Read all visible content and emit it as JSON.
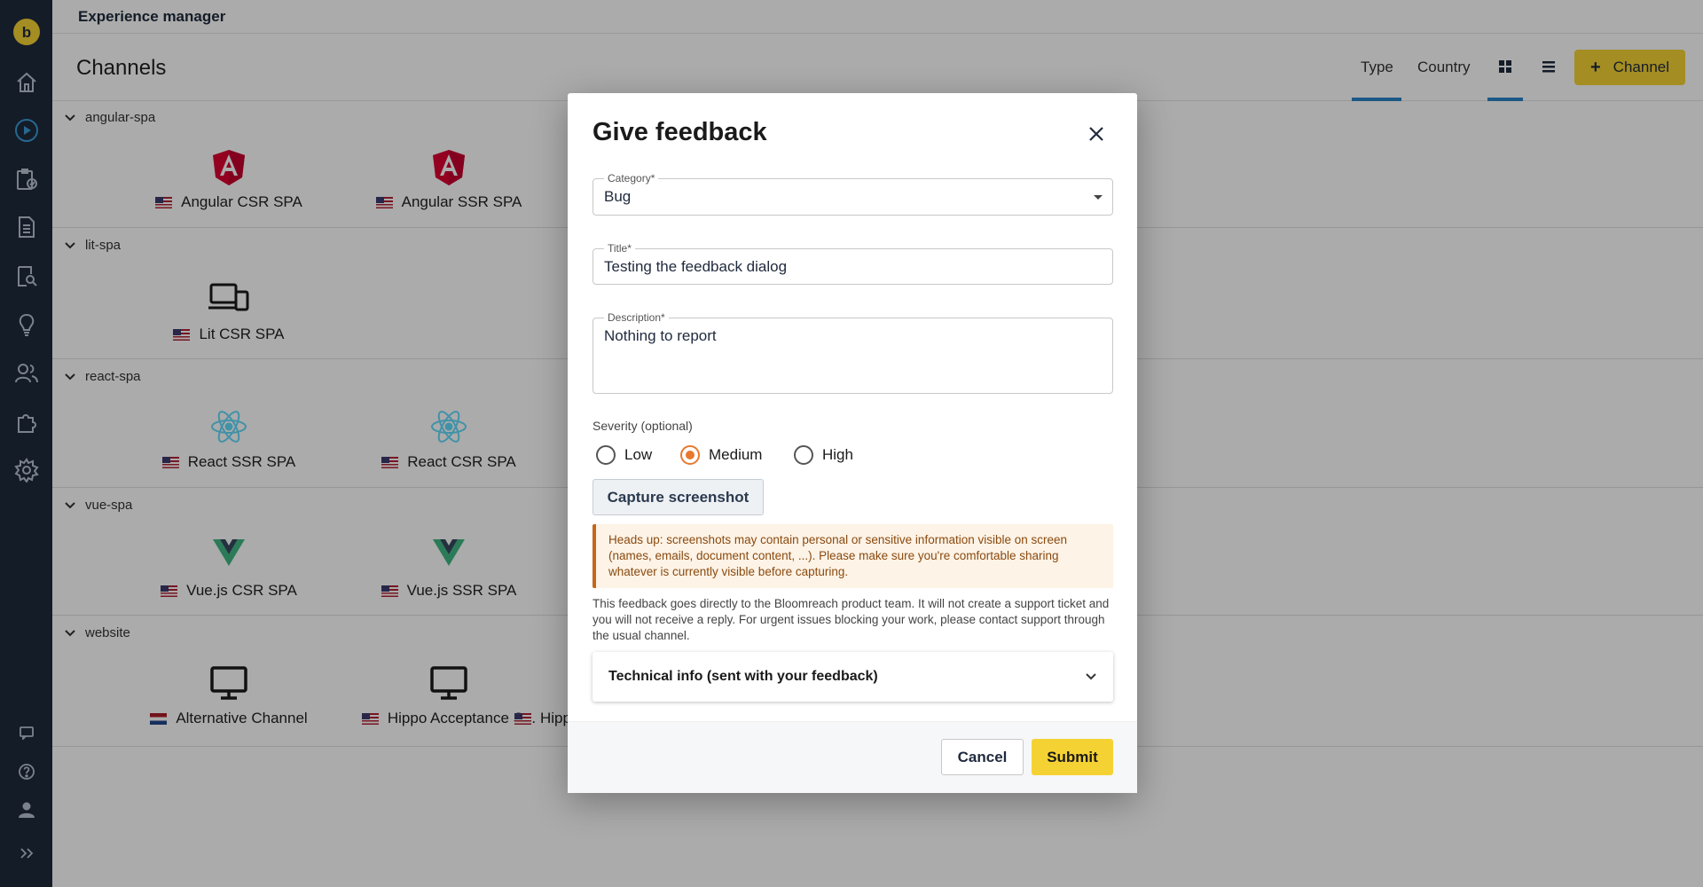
{
  "app": {
    "title": "Experience manager"
  },
  "sidebar": {
    "items": [
      {
        "name": "logo-icon",
        "label": "b"
      },
      {
        "name": "home-icon"
      },
      {
        "name": "play-icon"
      },
      {
        "name": "projects-icon"
      },
      {
        "name": "document-icon"
      },
      {
        "name": "content-search-icon"
      },
      {
        "name": "lightbulb-icon"
      },
      {
        "name": "users-icon"
      },
      {
        "name": "puzzle-icon"
      },
      {
        "name": "gear-icon"
      },
      {
        "name": "chat-icon"
      },
      {
        "name": "help-icon"
      },
      {
        "name": "user-icon"
      },
      {
        "name": "expand-icon"
      }
    ]
  },
  "header": {
    "title": "Channels",
    "tabs": [
      {
        "label": "Type",
        "active": true
      },
      {
        "label": "Country",
        "active": false
      }
    ],
    "view_modes": [
      "grid-view-icon",
      "list-view-icon"
    ],
    "add_button": {
      "label": "Channel",
      "icon": "+"
    }
  },
  "groups": [
    {
      "name": "angular-spa",
      "channels": [
        {
          "label": "Angular CSR SPA",
          "icon": "angular-icon",
          "flag": "us"
        },
        {
          "label": "Angular SSR SPA",
          "icon": "angular-icon",
          "flag": "us"
        }
      ]
    },
    {
      "name": "lit-spa",
      "channels": [
        {
          "label": "Lit CSR SPA",
          "icon": "devices-icon",
          "flag": "us"
        }
      ]
    },
    {
      "name": "react-spa",
      "channels": [
        {
          "label": "React SSR SPA",
          "icon": "react-icon",
          "flag": "us"
        },
        {
          "label": "React CSR SPA",
          "icon": "react-icon",
          "flag": "us"
        }
      ]
    },
    {
      "name": "vue-spa",
      "channels": [
        {
          "label": "Vue.js CSR SPA",
          "icon": "vue-icon",
          "flag": "us"
        },
        {
          "label": "Vue.js SSR SPA",
          "icon": "vue-icon",
          "flag": "us"
        }
      ]
    },
    {
      "name": "website",
      "channels": [
        {
          "label": "Alternative Channel",
          "icon": "monitor-icon",
          "flag": "nl"
        },
        {
          "label": "Hippo Acceptance S...",
          "icon": "monitor-icon",
          "flag": "us"
        },
        {
          "label": "Hipp",
          "icon": "monitor-icon",
          "flag": "us"
        }
      ]
    }
  ],
  "dialog": {
    "title": "Give feedback",
    "category": {
      "label": "Category*",
      "value": "Bug"
    },
    "title_field": {
      "label": "Title*",
      "value": "Testing the feedback dialog"
    },
    "description": {
      "label": "Description*",
      "value": "Nothing to report"
    },
    "severity": {
      "label": "Severity (optional)",
      "options": [
        "Low",
        "Medium",
        "High"
      ],
      "selected": "Medium"
    },
    "capture_button": "Capture screenshot",
    "warning": "Heads up: screenshots may contain personal or sensitive information visible on screen (names, emails, document content, ...). Please make sure you're comfortable sharing whatever is currently visible before capturing.",
    "note": "This feedback goes directly to the Bloomreach product team. It will not create a support ticket and you will not receive a reply. For urgent issues blocking your work, please contact support through the usual channel.",
    "technical_info": "Technical info (sent with your feedback)",
    "cancel": "Cancel",
    "submit": "Submit"
  },
  "colors": {
    "sidebar": "#1f2a3d",
    "accent": "#f5d234",
    "tab_indicator": "#2b83c7",
    "radio_selected": "#e8792e",
    "warning_border": "#c4661c"
  }
}
